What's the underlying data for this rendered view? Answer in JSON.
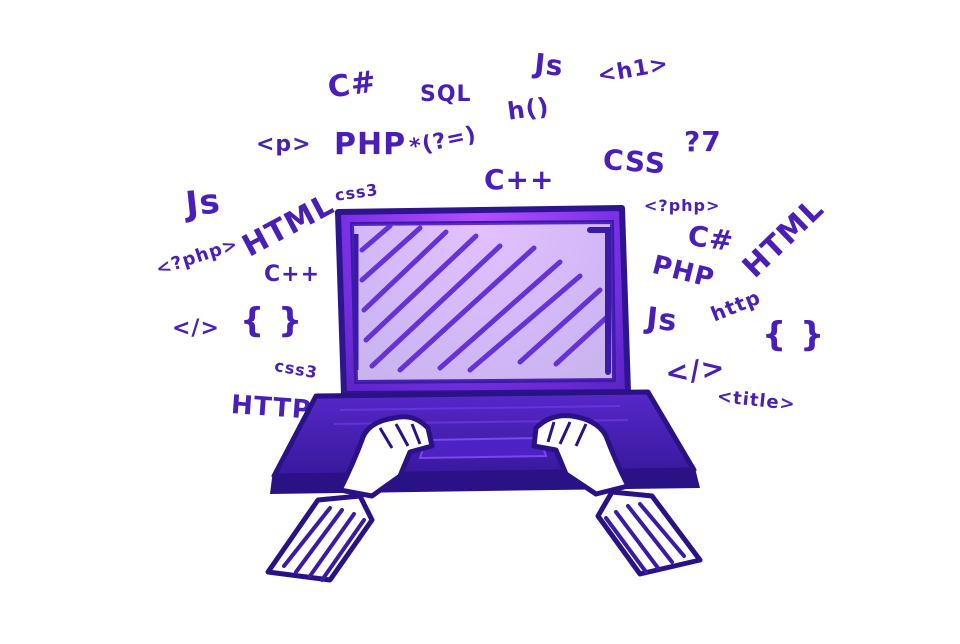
{
  "illustration": {
    "subject": "laptop-with-hands-typing",
    "colors": {
      "ink": "#4a1fb8",
      "ink_dark": "#2f148f",
      "glow": "#b34dff",
      "background": "#ffffff"
    }
  },
  "code_words": [
    "C#",
    "SQL",
    "Js",
    "h()",
    "<h1>",
    "<p>",
    "PHP",
    "*(?=)",
    "CSS",
    "?7",
    "C++",
    "Js",
    "css3",
    "HTML",
    "<?php>",
    "C#",
    "HTML",
    "<?php>",
    "C++",
    "PHP",
    "Js",
    "http",
    "{ }",
    "</>",
    "{ }",
    "css3",
    "</>",
    "<title>",
    "HTTP"
  ]
}
